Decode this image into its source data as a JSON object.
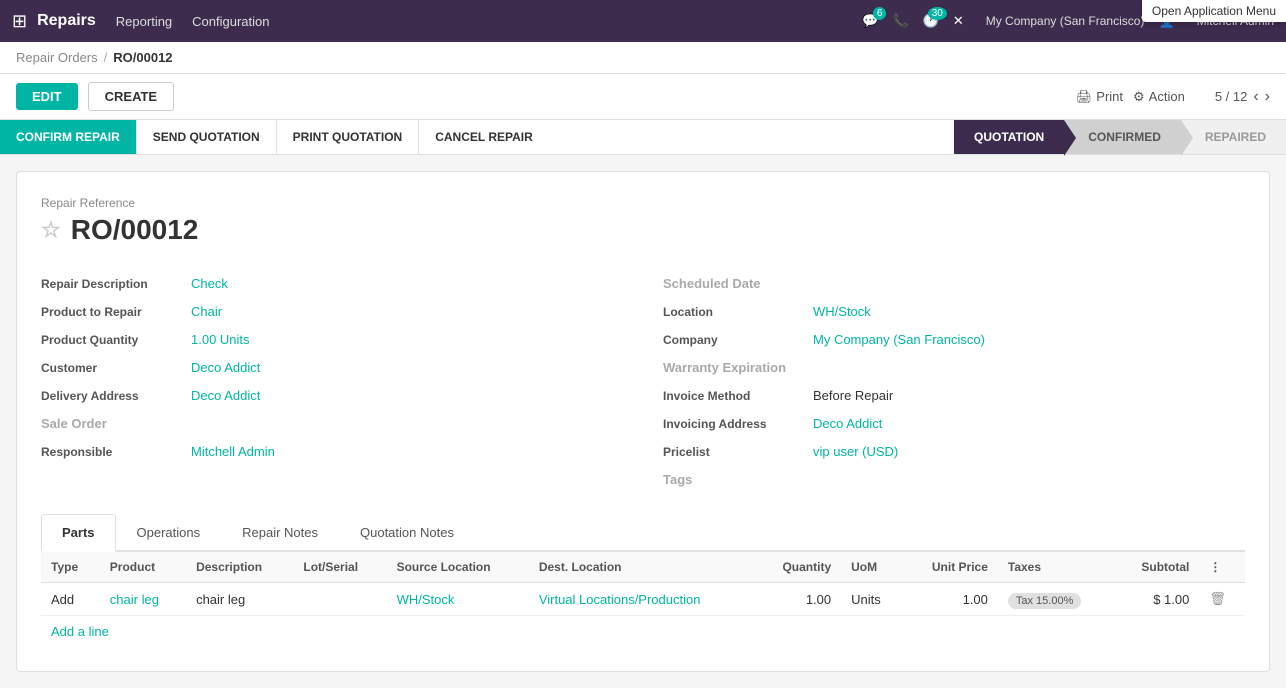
{
  "app": {
    "name": "Repairs",
    "nav_items": [
      "Reporting",
      "Configuration"
    ]
  },
  "topbar": {
    "chat_badge": "6",
    "activity_badge": "30",
    "company": "My Company (San Francisco)",
    "user": "Mitchell Admin",
    "open_app_tooltip": "Open Application Menu"
  },
  "breadcrumb": {
    "parent": "Repair Orders",
    "current": "RO/00012",
    "separator": "/"
  },
  "toolbar": {
    "edit_label": "EDIT",
    "create_label": "CREATE",
    "print_label": "Print",
    "action_label": "Action",
    "pagination": "5 / 12"
  },
  "action_bar": {
    "confirm_repair": "CONFIRM REPAIR",
    "send_quotation": "SEND QUOTATION",
    "print_quotation": "PRINT QUOTATION",
    "cancel_repair": "CANCEL REPAIR"
  },
  "status_pipeline": [
    {
      "label": "QUOTATION",
      "state": "active"
    },
    {
      "label": "CONFIRMED",
      "state": "pending"
    },
    {
      "label": "REPAIRED",
      "state": "pending"
    }
  ],
  "form": {
    "repair_reference_label": "Repair Reference",
    "repair_ref": "RO/00012",
    "left_fields": [
      {
        "label": "Repair Description",
        "value": "Check",
        "type": "teal"
      },
      {
        "label": "Product to Repair",
        "value": "Chair",
        "type": "teal"
      },
      {
        "label": "Product Quantity",
        "value": "1.00 Units",
        "type": "teal"
      },
      {
        "label": "Customer",
        "value": "Deco Addict",
        "type": "teal"
      },
      {
        "label": "Delivery Address",
        "value": "Deco Addict",
        "type": "teal"
      },
      {
        "label": "Sale Order",
        "value": "",
        "type": "gray"
      },
      {
        "label": "Responsible",
        "value": "Mitchell Admin",
        "type": "teal"
      }
    ],
    "right_fields": [
      {
        "label": "Scheduled Date",
        "value": "",
        "type": "gray"
      },
      {
        "label": "Location",
        "value": "WH/Stock",
        "type": "teal"
      },
      {
        "label": "Company",
        "value": "My Company (San Francisco)",
        "type": "teal"
      },
      {
        "label": "Warranty Expiration",
        "value": "",
        "type": "gray"
      },
      {
        "label": "Invoice Method",
        "value": "Before Repair",
        "type": "black"
      },
      {
        "label": "Invoicing Address",
        "value": "Deco Addict",
        "type": "teal"
      },
      {
        "label": "Pricelist",
        "value": "vip user (USD)",
        "type": "teal"
      },
      {
        "label": "Tags",
        "value": "",
        "type": "gray"
      }
    ]
  },
  "tabs": [
    {
      "id": "parts",
      "label": "Parts",
      "active": true
    },
    {
      "id": "operations",
      "label": "Operations",
      "active": false
    },
    {
      "id": "repair-notes",
      "label": "Repair Notes",
      "active": false
    },
    {
      "id": "quotation-notes",
      "label": "Quotation Notes",
      "active": false
    }
  ],
  "table": {
    "columns": [
      "Type",
      "Product",
      "Description",
      "Lot/Serial",
      "Source Location",
      "Dest. Location",
      "Quantity",
      "UoM",
      "Unit Price",
      "Taxes",
      "Subtotal"
    ],
    "rows": [
      {
        "type": "Add",
        "product": "chair leg",
        "description": "chair leg",
        "lot_serial": "",
        "source_location": "WH/Stock",
        "dest_location": "Virtual Locations/Production",
        "quantity": "1.00",
        "uom": "Units",
        "unit_price": "1.00",
        "taxes": "Tax 15.00%",
        "subtotal": "$ 1.00"
      }
    ],
    "add_line_label": "Add a line"
  }
}
